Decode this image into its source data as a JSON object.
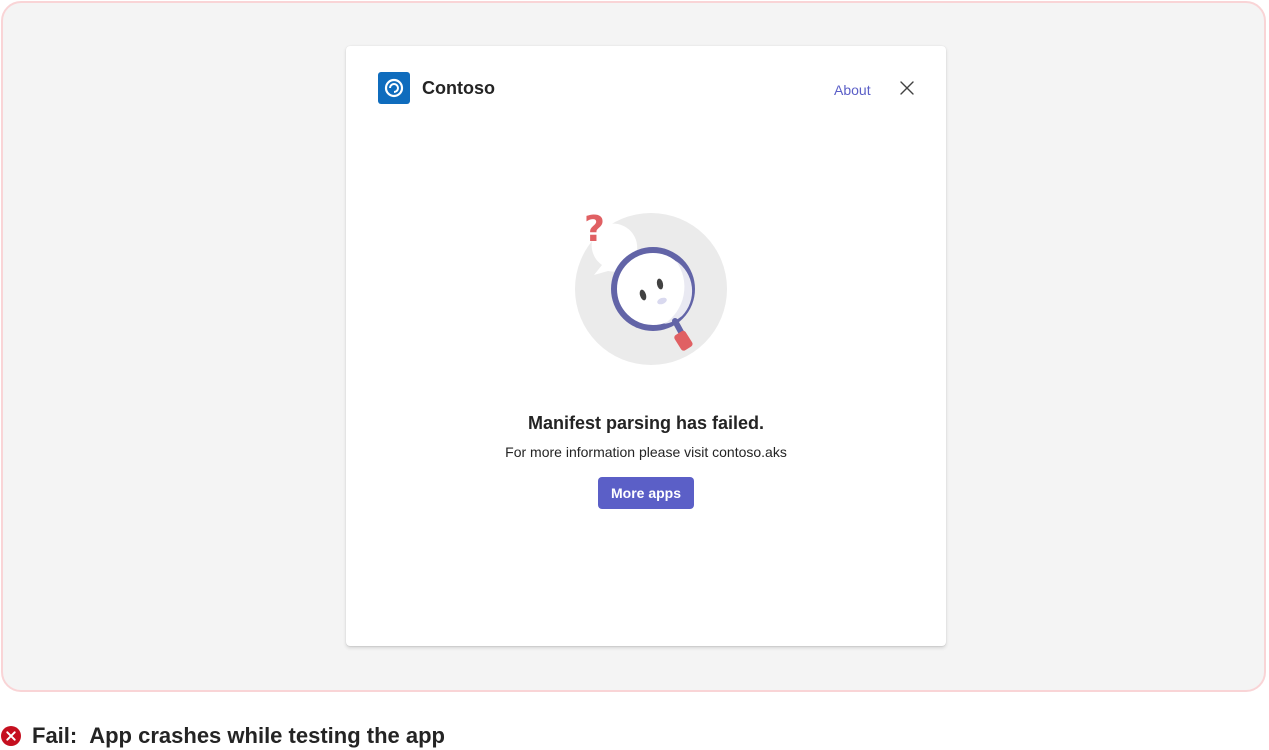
{
  "dialog": {
    "app_name": "Contoso",
    "about_label": "About",
    "close_icon": "close-icon",
    "app_logo_icon": "contoso-logo-icon",
    "illustration": "magnifying-glass-question-illustration",
    "error_title": "Manifest parsing has failed.",
    "error_subtitle": "For more information please visit contoso.aks",
    "more_apps_label": "More apps"
  },
  "caption": {
    "status_icon": "fail-icon",
    "label": "Fail:",
    "text": "App crashes while testing the app"
  },
  "colors": {
    "brand": "#5b5fc7",
    "logo": "#0f6cbd",
    "fail": "#c50f1f",
    "frame_border": "#f9d4d6",
    "frame_bg": "#f4f4f4"
  }
}
